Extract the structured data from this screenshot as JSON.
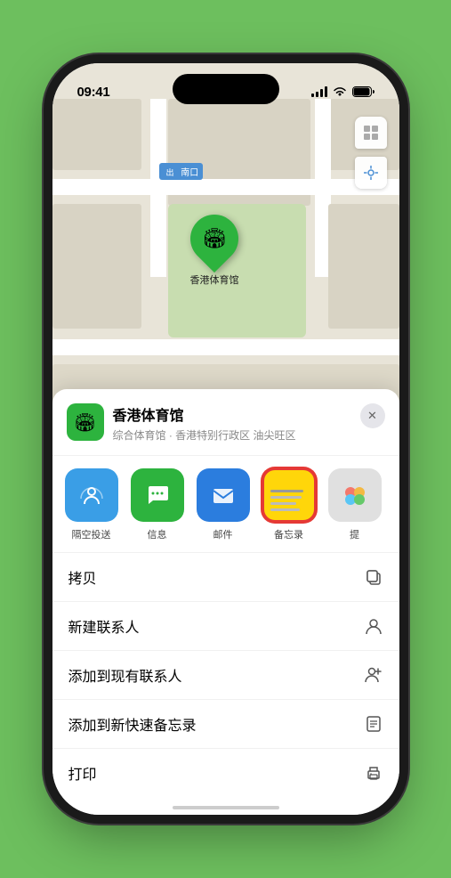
{
  "status": {
    "time": "09:41",
    "location_arrow": "▶"
  },
  "map": {
    "label_nankou": "南口",
    "stadium_label": "香港体育馆"
  },
  "venue": {
    "name": "香港体育馆",
    "description": "综合体育馆 · 香港特别行政区 油尖旺区",
    "icon": "🏟"
  },
  "share_actions": [
    {
      "id": "airdrop",
      "label": "隔空投送",
      "type": "airdrop"
    },
    {
      "id": "messages",
      "label": "信息",
      "type": "messages"
    },
    {
      "id": "mail",
      "label": "邮件",
      "type": "mail"
    },
    {
      "id": "notes",
      "label": "备忘录",
      "type": "notes"
    },
    {
      "id": "more",
      "label": "提",
      "type": "more"
    }
  ],
  "action_items": [
    {
      "id": "copy",
      "label": "拷贝",
      "icon": "copy"
    },
    {
      "id": "new-contact",
      "label": "新建联系人",
      "icon": "person"
    },
    {
      "id": "add-existing",
      "label": "添加到现有联系人",
      "icon": "person-add"
    },
    {
      "id": "add-notes",
      "label": "添加到新快速备忘录",
      "icon": "note"
    },
    {
      "id": "print",
      "label": "打印",
      "icon": "print"
    }
  ],
  "buttons": {
    "close": "✕"
  }
}
